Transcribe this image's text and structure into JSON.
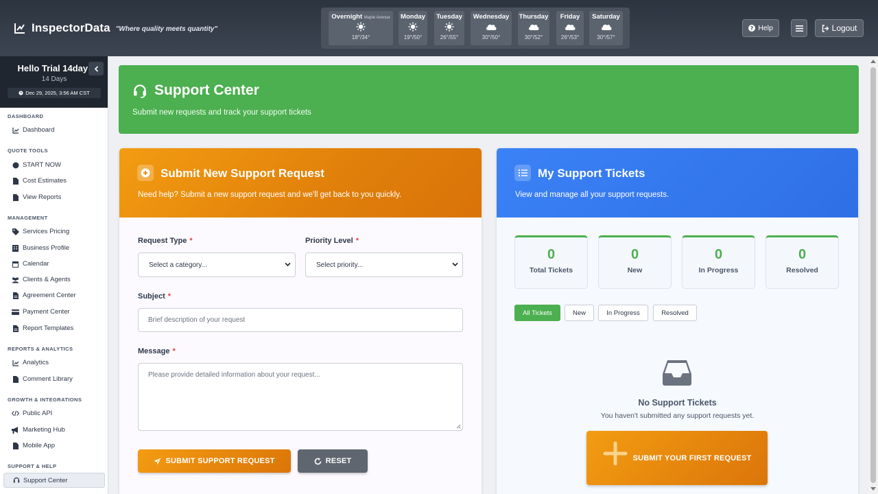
{
  "brand": {
    "name": "InspectorData",
    "tagline": "\"Where quality meets quantity\""
  },
  "weather": {
    "location": "Maple Avenue",
    "days": [
      {
        "name": "Overnight",
        "icon": "sun-icon",
        "temps": "18°/34°"
      },
      {
        "name": "Monday",
        "icon": "sun-icon",
        "temps": "19°/50°"
      },
      {
        "name": "Tuesday",
        "icon": "sun-icon",
        "temps": "26°/55°"
      },
      {
        "name": "Wednesday",
        "icon": "cloud-icon",
        "temps": "30°/50°"
      },
      {
        "name": "Thursday",
        "icon": "cloud-icon",
        "temps": "30°/52°"
      },
      {
        "name": "Friday",
        "icon": "cloud-icon",
        "temps": "26°/53°"
      },
      {
        "name": "Saturday",
        "icon": "cloud-icon",
        "temps": "30°/57°"
      }
    ]
  },
  "topbar": {
    "help_label": "Help",
    "logout_label": "Logout"
  },
  "user": {
    "greeting": "Hello Trial 14day!",
    "days": "14 Days",
    "datetime": "Dec 29, 2025, 3:56 AM CST"
  },
  "nav": {
    "sections": [
      "DASHBOARD",
      "QUOTE TOOLS",
      "MANAGEMENT",
      "REPORTS & ANALYTICS",
      "GROWTH & INTEGRATIONS",
      "SUPPORT & HELP"
    ],
    "items": [
      "Dashboard",
      "START NOW",
      "Cost Estimates",
      "View Reports",
      "Services Pricing",
      "Business Profile",
      "Calendar",
      "Clients & Agents",
      "Agreement Center",
      "Payment Center",
      "Report Templates",
      "Analytics",
      "Comment Library",
      "Public API",
      "Marketing Hub",
      "Mobile App",
      "Support Center"
    ]
  },
  "hero": {
    "title": "Support Center",
    "subtitle": "Submit new requests and track your support tickets"
  },
  "form": {
    "title": "Submit New Support Request",
    "subtitle": "Need help? Submit a new support request and we'll get back to you quickly.",
    "request_type_label": "Request Type",
    "request_type_value": "Select a category...",
    "priority_label": "Priority Level",
    "priority_value": "Select priority...",
    "subject_label": "Subject",
    "subject_placeholder": "Brief description of your request",
    "message_label": "Message",
    "message_placeholder": "Please provide detailed information about your request...",
    "required_mark": "*",
    "submit_label": "SUBMIT SUPPORT REQUEST",
    "reset_label": "RESET"
  },
  "tickets": {
    "title": "My Support Tickets",
    "subtitle": "View and manage all your support requests.",
    "stats": [
      {
        "value": "0",
        "label": "Total Tickets"
      },
      {
        "value": "0",
        "label": "New"
      },
      {
        "value": "0",
        "label": "In Progress"
      },
      {
        "value": "0",
        "label": "Resolved"
      }
    ],
    "filters": [
      "All Tickets",
      "New",
      "In Progress",
      "Resolved"
    ],
    "active_filter": "All Tickets",
    "empty_title": "No Support Tickets",
    "empty_subtitle": "You haven't submitted any support requests yet.",
    "cta_label": "SUBMIT YOUR FIRST REQUEST"
  },
  "colors": {
    "green": "#4caf50",
    "orange": "#f39c12",
    "blue": "#3b82f6",
    "dark": "#2c3440"
  }
}
